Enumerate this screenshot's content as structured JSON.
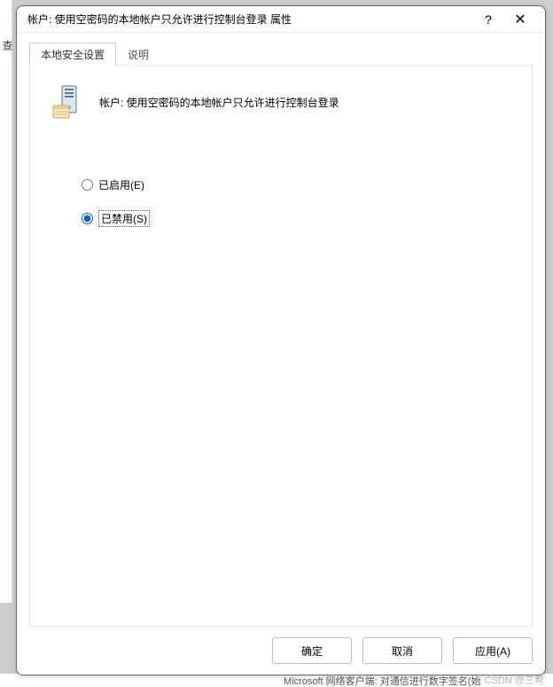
{
  "titlebar": {
    "title": "帐户: 使用空密码的本地帐户只允许进行控制台登录 属性",
    "help": "?",
    "close": "✕"
  },
  "tabs": {
    "active": "本地安全设置",
    "inactive": "说明"
  },
  "policy": {
    "title": "帐户: 使用空密码的本地帐户只允许进行控制台登录"
  },
  "radio": {
    "enabled": "已启用(E)",
    "disabled": "已禁用(S)"
  },
  "buttons": {
    "ok": "确定",
    "cancel": "取消",
    "apply": "应用(A)"
  },
  "background": {
    "sidebar_hint": "查",
    "bottom_text": "Microsoft 网络客户端: 对通信进行数字签名(始",
    "watermark": "CSDN @三希"
  }
}
